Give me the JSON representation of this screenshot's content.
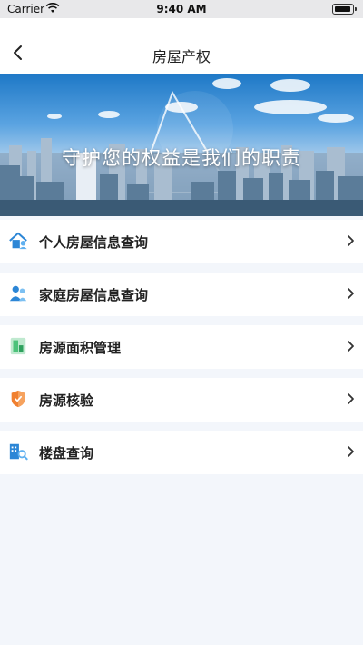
{
  "status_bar": {
    "carrier": "Carrier",
    "time": "9:40 AM"
  },
  "nav": {
    "title": "房屋产权"
  },
  "banner": {
    "slogan": "守护您的权益是我们的职责"
  },
  "menu": [
    {
      "label": "个人房屋信息查询",
      "icon": "house-user-icon",
      "color": "#2c86d6"
    },
    {
      "label": "家庭房屋信息查询",
      "icon": "family-icon",
      "color": "#2c86d6"
    },
    {
      "label": "房源面积管理",
      "icon": "area-icon",
      "color": "#4cc27a"
    },
    {
      "label": "房源核验",
      "icon": "shield-icon",
      "color": "#f08030"
    },
    {
      "label": "楼盘查询",
      "icon": "building-search-icon",
      "color": "#2c86d6"
    }
  ]
}
